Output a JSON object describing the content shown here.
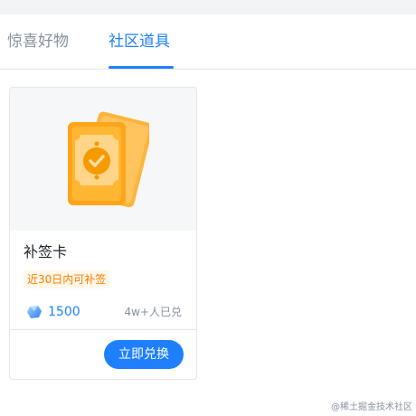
{
  "tabs": [
    {
      "label": "惊喜好物",
      "active": false
    },
    {
      "label": "社区道具",
      "active": true
    }
  ],
  "product": {
    "title": "补签卡",
    "tag": "近30日内可补签",
    "price": "1500",
    "price_icon": "ore-icon",
    "exchanged_count": "4w+人已兑",
    "button_label": "立即兑换",
    "image_icon": "sign-card-icon"
  },
  "watermark": "@稀土掘金技术社区",
  "colors": {
    "accent": "#1e80ff",
    "tag_text": "#ff7d00",
    "tag_bg": "#fff7e8",
    "card_gold": "#ffa500"
  }
}
